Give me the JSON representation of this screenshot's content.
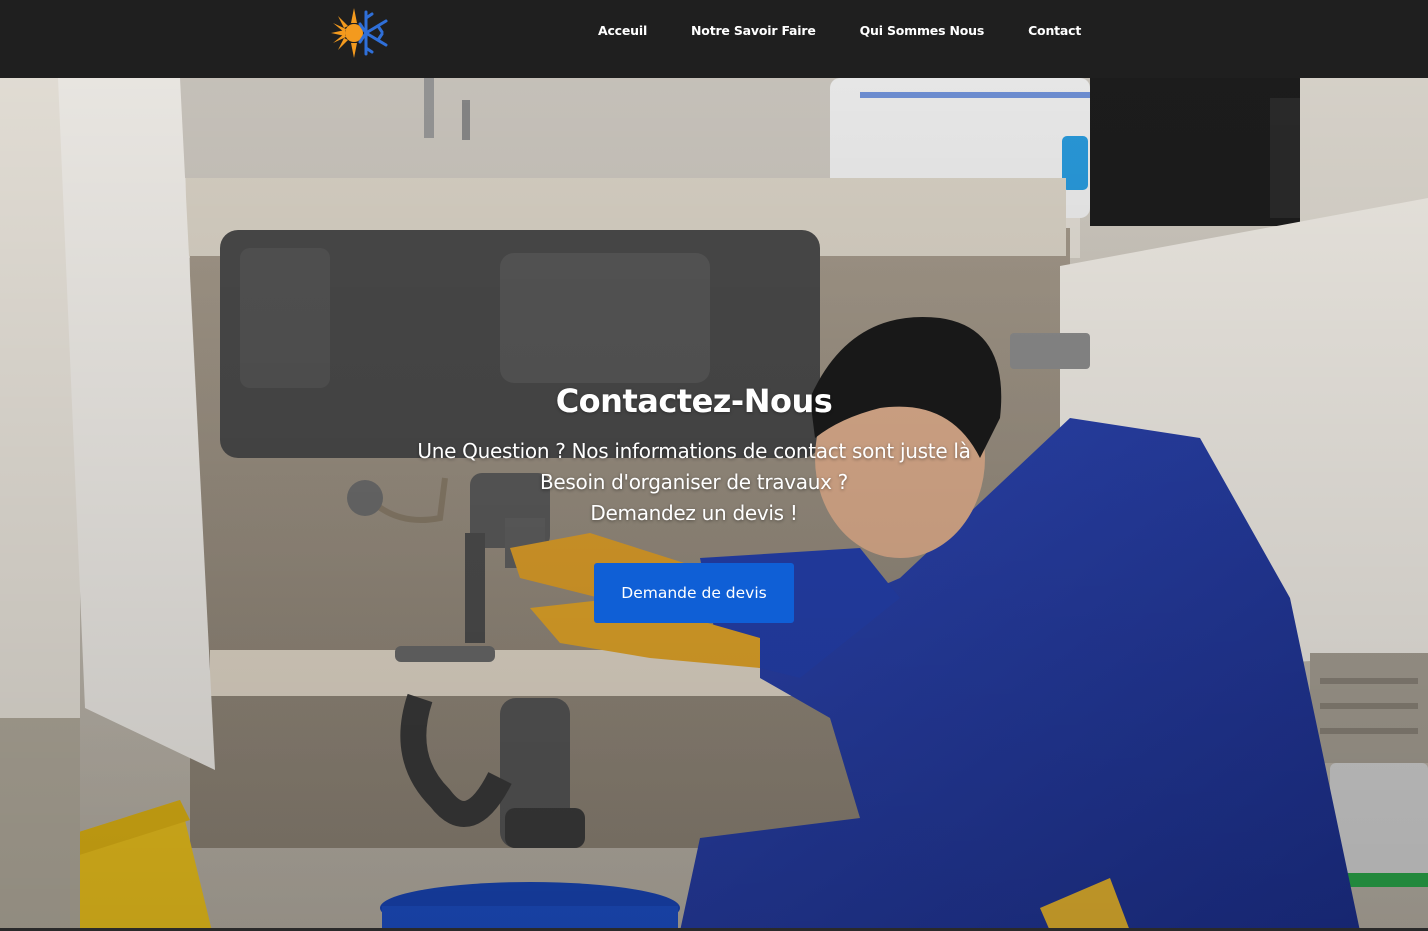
{
  "nav": {
    "links": [
      "Acceuil",
      "Notre Savoir Faire",
      "Qui Sommes Nous",
      "Contact"
    ]
  },
  "logo": {
    "icon": "sun-snowflake-logo-icon",
    "colors": {
      "sun": "#f39a1e",
      "flake": "#2f6fd8"
    }
  },
  "hero": {
    "title": "Contactez-Nous",
    "lines": [
      "Une Question ? Nos informations de contact sont juste là",
      "Besoin d'organiser de travaux ?",
      "Demandez un devis !"
    ],
    "cta_label": "Demande de devis",
    "background": "plumber-repairing-sink-photo"
  },
  "colors": {
    "navbar": "#1f1f1f",
    "cta": "#0f5fd6",
    "text": "#ffffff"
  }
}
